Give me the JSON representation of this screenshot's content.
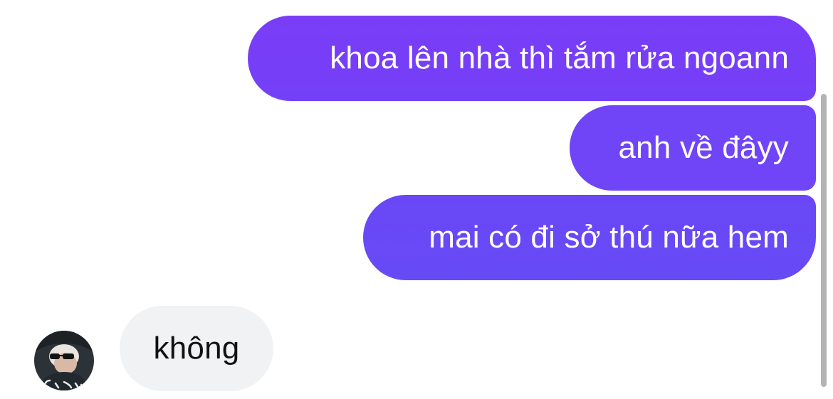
{
  "conversation": {
    "outgoing": [
      {
        "text": "khoa lên nhà thì tắm rửa ngoann"
      },
      {
        "text": "anh về đâyy"
      },
      {
        "text": "mai có đi sở thú nữa hem"
      }
    ],
    "incoming": [
      {
        "text": "không"
      }
    ]
  },
  "colors": {
    "outgoing_bubble": "#7044f7",
    "incoming_bubble": "#f1f2f4",
    "background": "#ffffff"
  }
}
